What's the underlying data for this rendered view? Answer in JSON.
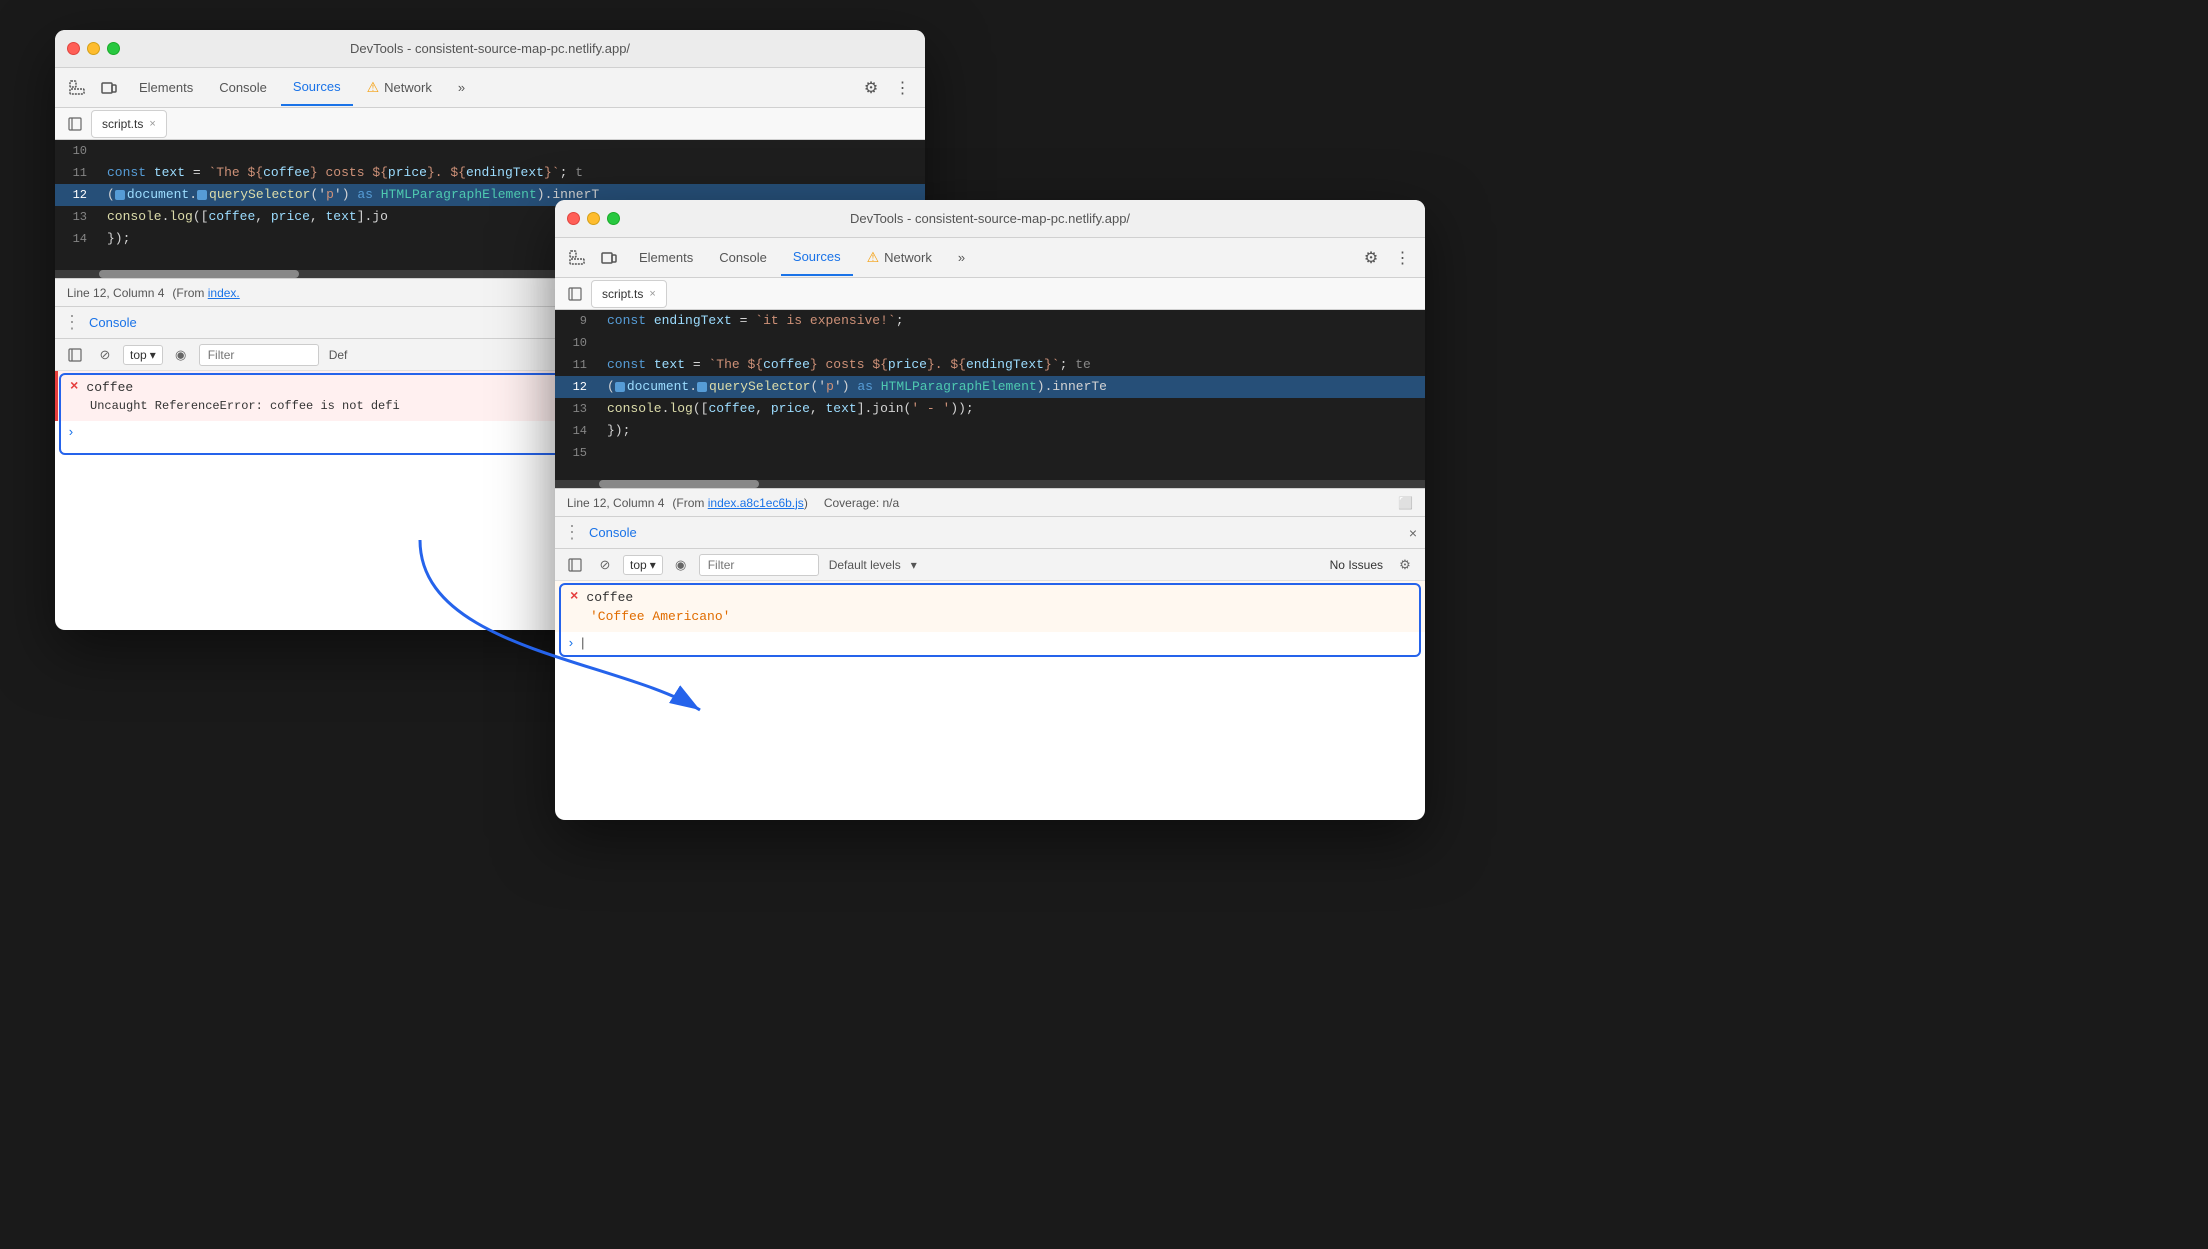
{
  "windowBack": {
    "titleBar": {
      "title": "DevTools - consistent-source-map-pc.netlify.app/"
    },
    "toolbar": {
      "tabs": [
        {
          "label": "Elements",
          "active": false
        },
        {
          "label": "Console",
          "active": false
        },
        {
          "label": "Sources",
          "active": true
        },
        {
          "label": "Network",
          "active": false,
          "warn": true
        }
      ],
      "moreLabel": "»"
    },
    "fileTab": {
      "filename": "script.ts",
      "closeIcon": "×"
    },
    "codeLines": [
      {
        "num": "10",
        "highlighted": false,
        "content": ""
      },
      {
        "num": "11",
        "highlighted": false,
        "content": "const text = `The ${coffee} costs ${price}. ${endingText}`;  t"
      },
      {
        "num": "12",
        "highlighted": true,
        "content": "(▸document.▸querySelector('p') as HTMLParagraphElement).innerT"
      },
      {
        "num": "13",
        "highlighted": false,
        "content": "console.log([coffee, price, text].jo"
      },
      {
        "num": "14",
        "highlighted": false,
        "content": "});"
      }
    ],
    "statusBar": {
      "position": "Line 12, Column 4",
      "fromText": "(From",
      "fromLink": "index.",
      "closeParen": ""
    },
    "console": {
      "title": "Console",
      "toolbar": {
        "topLabel": "top",
        "filterPlaceholder": "Filter",
        "defLabel": "Def"
      },
      "errorRow": {
        "symbol": "×",
        "title": "coffee",
        "message": "Uncaught ReferenceError:",
        "messageDetail": "coffee is not defi"
      }
    }
  },
  "windowFront": {
    "titleBar": {
      "title": "DevTools - consistent-source-map-pc.netlify.app/"
    },
    "toolbar": {
      "tabs": [
        {
          "label": "Elements",
          "active": false
        },
        {
          "label": "Console",
          "active": false
        },
        {
          "label": "Sources",
          "active": true
        },
        {
          "label": "Network",
          "active": false,
          "warn": true
        }
      ],
      "moreLabel": "»"
    },
    "fileTab": {
      "filename": "script.ts",
      "closeIcon": "×"
    },
    "codeLines": [
      {
        "num": "9",
        "highlighted": false,
        "content": "const endingText = `it is expensive!`;"
      },
      {
        "num": "10",
        "highlighted": false,
        "content": ""
      },
      {
        "num": "11",
        "highlighted": false,
        "content": "const text = `The ${coffee} costs ${price}. ${endingText}`;  te"
      },
      {
        "num": "12",
        "highlighted": true,
        "content": "(▸document.▸querySelector('p') as HTMLParagraphElement).innerTe"
      },
      {
        "num": "13",
        "highlighted": false,
        "content": "console.log([coffee, price, text].join(' - '));"
      },
      {
        "num": "14",
        "highlighted": false,
        "content": "});"
      },
      {
        "num": "15",
        "highlighted": false,
        "content": ""
      }
    ],
    "statusBar": {
      "position": "Line 12, Column 4",
      "fromText": "(From",
      "fromLink": "index.a8c1ec6b.js",
      "coverageLabel": "Coverage: n/a"
    },
    "console": {
      "title": "Console",
      "closeIcon": "×",
      "toolbar": {
        "topLabel": "top",
        "filterPlaceholder": "Filter",
        "defLevelsLabel": "Default levels",
        "noIssuesLabel": "No Issues"
      },
      "successRow": {
        "symbol": "×",
        "title": "coffee",
        "value": "'Coffee Americano'"
      }
    },
    "prompt": {
      "arrow": ">",
      "cursor": "|"
    }
  },
  "icons": {
    "gear": "⚙",
    "moreVert": "⋮",
    "inspect": "⬚",
    "deviceToggle": "▭",
    "sidebarExpand": "▷",
    "circle": "⊘",
    "eye": "◉",
    "chevronDown": "▾",
    "screenshot": "⬜",
    "close": "×"
  }
}
